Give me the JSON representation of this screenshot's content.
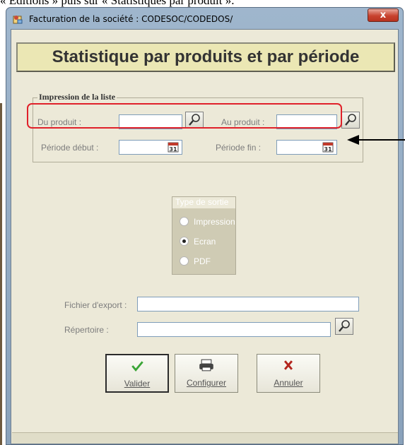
{
  "doc_top": "« Éditions » puis sur « Statistiques par produit ».",
  "window": {
    "title": "Facturation de la société : CODESOC/CODEDOS/",
    "close": "x"
  },
  "header": {
    "title": "Statistique par produits et par période"
  },
  "impression": {
    "legend": "Impression de la liste",
    "du_produit_label": "Du produit :",
    "au_produit_label": "Au produit :",
    "periode_debut_label": "Période début :",
    "periode_fin_label": "Période fin :",
    "calendar_day": "31"
  },
  "sortie": {
    "title": "Type de sortie",
    "options": [
      "Impression",
      "Ecran",
      "PDF"
    ],
    "selected": "Ecran"
  },
  "export": {
    "fichier_label": "Fichier d'export :",
    "repertoire_label": "Répertoire :"
  },
  "buttons": {
    "valider": "Valider",
    "configurer": "Configurer",
    "annuler": "Annuler"
  },
  "icons": {
    "lookup": "magnifier-icon",
    "calendar": "calendar-icon",
    "valider": "check-icon",
    "configurer": "printer-icon",
    "annuler": "cross-icon"
  },
  "colors": {
    "highlight": "#e0212a",
    "banner_bg": "#ebe7b4",
    "accent_check": "#3aa536"
  }
}
